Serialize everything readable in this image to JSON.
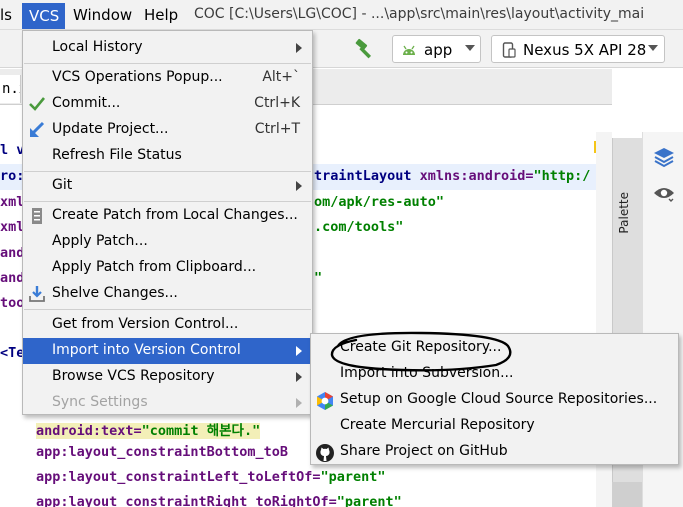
{
  "menubar": {
    "items": [
      "ls",
      "VCS",
      "Window",
      "Help"
    ],
    "title": "COC [C:\\Users\\LG\\COC] - ...\\app\\src\\main\\res\\layout\\activity_mai"
  },
  "toolbar": {
    "run_config": "app",
    "device": "Nexus 5X API 28"
  },
  "editor": {
    "tab_fragment": "n.x",
    "lines": {
      "l1": "l v",
      "l2_prefix": "ro:",
      "l2_tag": "traintLayout",
      "l2_attr": " xmlns:android=",
      "l2_val": "\"http:/",
      "l3_prefix": "xml",
      "l3_val": "om/apk/res-auto\"",
      "l4_prefix": "xml",
      "l4_val": ".com/tools\"",
      "l5_prefix": "and",
      "l6_prefix": "and",
      "l6_val": "\"",
      "l7_prefix": "too",
      "l8_prefix": "<Te",
      "l9_attr": "android:text=",
      "l9_val": "\"commit 해본다.\"",
      "l10_attr": "app:layout_constraintBottom_toB",
      "l11_attr": "app:layout_constraintLeft_toLeftOf=",
      "l11_val": "\"parent\"",
      "l12_attr": "app:layout_constraintRight_toRightOf=",
      "l12_val": "\"parent\""
    }
  },
  "palette_label": "Palette",
  "vcs_menu": {
    "items": [
      {
        "label": "Local History",
        "shortcut": "",
        "submenu": true
      },
      {
        "label": "VCS Operations Popup...",
        "shortcut": "Alt+`",
        "submenu": false
      },
      {
        "label": "Commit...",
        "shortcut": "Ctrl+K",
        "submenu": false,
        "icon": "check-icon"
      },
      {
        "label": "Update Project...",
        "shortcut": "Ctrl+T",
        "submenu": false,
        "icon": "update-arrow-icon"
      },
      {
        "label": "Refresh File Status",
        "shortcut": "",
        "submenu": false
      },
      {
        "label": "Git",
        "shortcut": "",
        "submenu": true
      },
      {
        "label": "Create Patch from Local Changes...",
        "shortcut": "",
        "submenu": false,
        "icon": "patch-icon"
      },
      {
        "label": "Apply Patch...",
        "shortcut": "",
        "submenu": false
      },
      {
        "label": "Apply Patch from Clipboard...",
        "shortcut": "",
        "submenu": false
      },
      {
        "label": "Shelve Changes...",
        "shortcut": "",
        "submenu": false,
        "icon": "shelve-icon"
      },
      {
        "label": "Get from Version Control...",
        "shortcut": "",
        "submenu": false
      },
      {
        "label": "Import into Version Control",
        "shortcut": "",
        "submenu": true
      },
      {
        "label": "Browse VCS Repository",
        "shortcut": "",
        "submenu": true
      },
      {
        "label": "Sync Settings",
        "shortcut": "",
        "submenu": true
      }
    ]
  },
  "import_submenu": {
    "items": [
      {
        "label": "Create Git Repository..."
      },
      {
        "label": "Import into Subversion..."
      },
      {
        "label": "Setup on Google Cloud Source Repositories...",
        "icon": "google-cloud-icon"
      },
      {
        "label": "Create Mercurial Repository"
      },
      {
        "label": "Share Project on GitHub",
        "icon": "github-icon"
      }
    ]
  },
  "colors": {
    "menu_highlight": "#2f65ca",
    "xml_tag": "#000080",
    "xml_attr": "#660e7a",
    "xml_string": "#008000"
  }
}
